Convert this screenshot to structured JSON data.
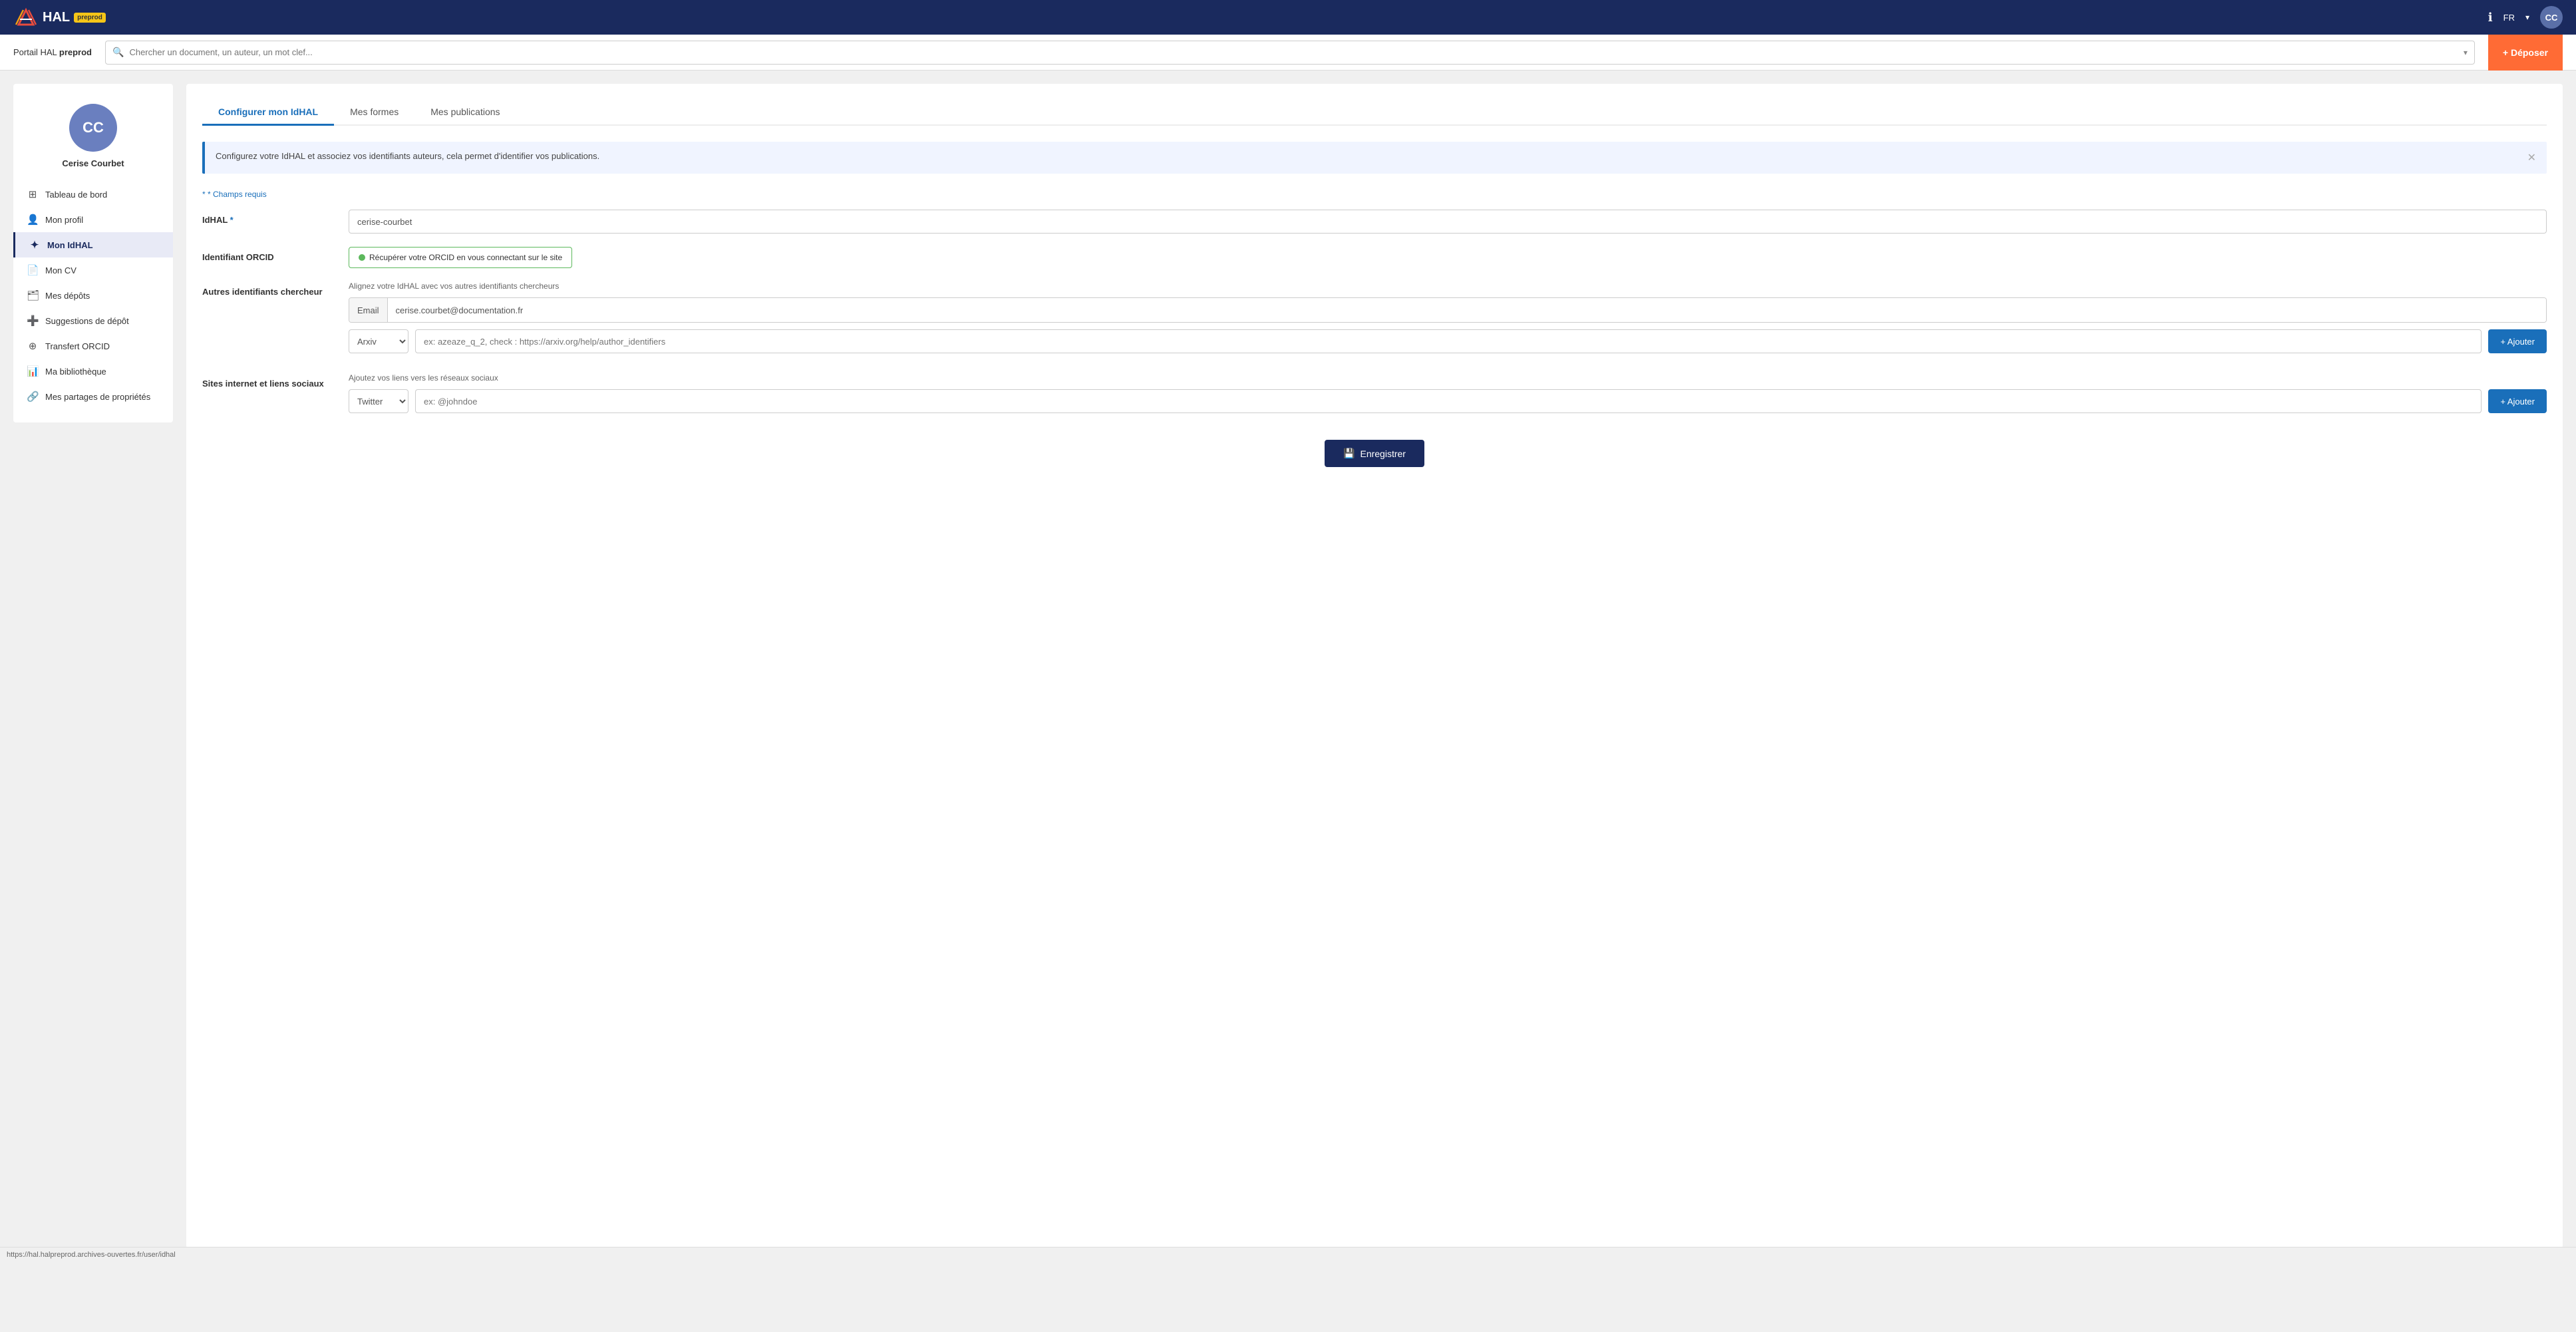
{
  "topnav": {
    "logo_text": "HAL",
    "badge": "preprod",
    "lang": "FR",
    "avatar_initials": "CC",
    "info_icon": "ℹ"
  },
  "searchbar": {
    "portal_label": "Portail HAL",
    "portal_name": "preprod",
    "placeholder": "Chercher un document, un auteur, un mot clef...",
    "deposit_btn": "+ Déposer"
  },
  "sidebar": {
    "avatar_initials": "CC",
    "username": "Cerise Courbet",
    "items": [
      {
        "id": "tableau-de-bord",
        "label": "Tableau de bord",
        "icon": "⊞"
      },
      {
        "id": "mon-profil",
        "label": "Mon profil",
        "icon": "👤"
      },
      {
        "id": "mon-idhal",
        "label": "Mon IdHAL",
        "icon": "✦",
        "active": true
      },
      {
        "id": "mon-cv",
        "label": "Mon CV",
        "icon": "📄"
      },
      {
        "id": "mes-depots",
        "label": "Mes dépôts",
        "icon": "🗂"
      },
      {
        "id": "suggestions-depot",
        "label": "Suggestions de dépôt",
        "icon": "➕"
      },
      {
        "id": "transfert-orcid",
        "label": "Transfert ORCID",
        "icon": "⊕"
      },
      {
        "id": "ma-bibliotheque",
        "label": "Ma bibliothèque",
        "icon": "📊"
      },
      {
        "id": "mes-partages",
        "label": "Mes partages de propriétés",
        "icon": "🔗"
      }
    ]
  },
  "tabs": [
    {
      "id": "configurer",
      "label": "Configurer mon IdHAL",
      "active": true
    },
    {
      "id": "mes-formes",
      "label": "Mes formes",
      "active": false
    },
    {
      "id": "mes-publications",
      "label": "Mes publications",
      "active": false
    }
  ],
  "banner": {
    "text": "Configurez votre IdHAL et associez vos identifiants auteurs, cela permet d'identifier vos publications."
  },
  "form": {
    "required_note": "* Champs requis",
    "idhal_label": "IdHAL",
    "idhal_required": "*",
    "idhal_value": "cerise-courbet",
    "orcid_label": "Identifiant ORCID",
    "orcid_btn": "Récupérer votre ORCID en vous connectant sur le site",
    "other_ids_label": "Autres identifiants chercheur",
    "other_ids_hint": "Alignez votre IdHAL avec vos autres identifiants chercheurs",
    "email_prefix": "Email",
    "email_value": "cerise.courbet@documentation.fr",
    "arxiv_dropdown": "Arxiv",
    "arxiv_placeholder": "ex: azeaze_q_2, check : https://arxiv.org/help/author_identifiers",
    "add_btn_1": "+ Ajouter",
    "social_label": "Sites internet et liens sociaux",
    "social_hint": "Ajoutez vos liens vers les réseaux sociaux",
    "twitter_dropdown": "Twitter",
    "twitter_placeholder": "ex: @johndoe",
    "add_btn_2": "+ Ajouter",
    "save_btn": "Enregistrer"
  },
  "statusbar": {
    "url": "https://hal.halpreprod.archives-ouvertes.fr/user/idhal"
  }
}
